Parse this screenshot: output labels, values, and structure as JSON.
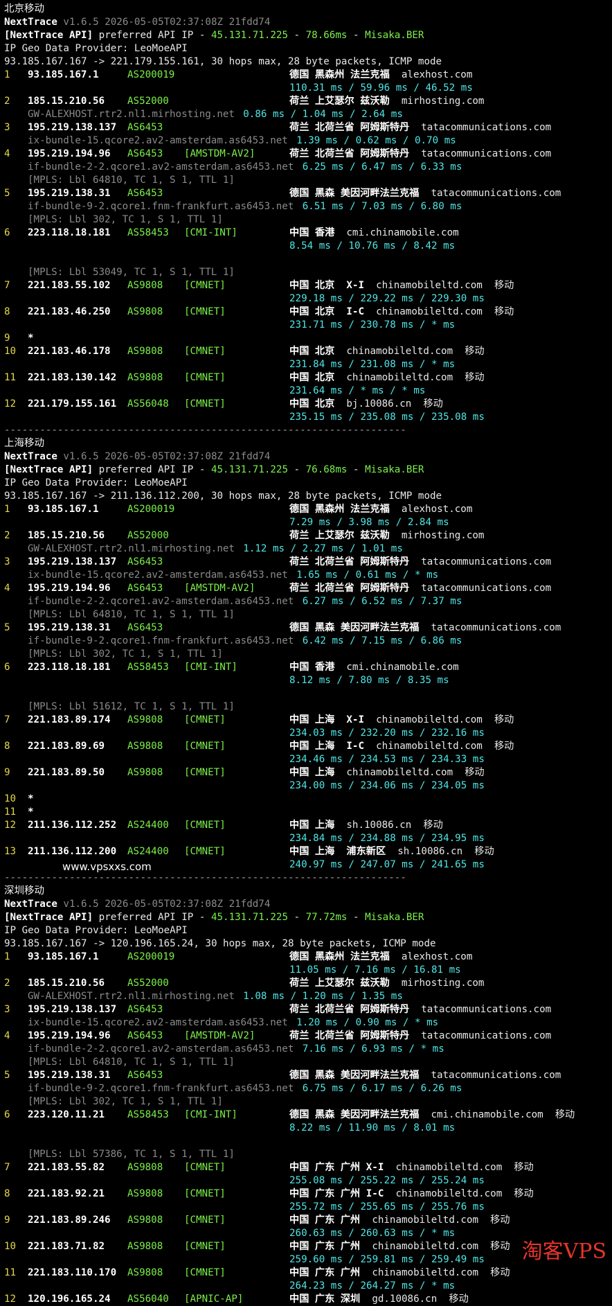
{
  "sections": [
    {
      "title": "北京移动",
      "header": {
        "app": "NextTrace",
        "version": "v1.6.5 2026-05-05T02:37:08Z 21fdd74",
        "api_label": "[NextTrace API]",
        "api_text": " preferred API IP - ",
        "api_ip": "45.131.71.225",
        "dash1": " - ",
        "latency": "78.66ms",
        "dash2": " - ",
        "node": "Misaka.BER",
        "provider": "IP Geo Data Provider: LeoMoeAPI",
        "route": "93.185.167.167 -> 221.179.155.161, 30 hops max, 28 byte packets, ICMP mode"
      },
      "hops": [
        {
          "hop": "1",
          "ip": "93.185.167.1",
          "asn": "AS200019",
          "tag": "",
          "geo": "德国 黑森州 法兰克福",
          "host": "alexhost.com",
          "isp": "",
          "rtt": "110.31 ms / 59.96 ms / 46.52 ms",
          "sub": []
        },
        {
          "hop": "2",
          "ip": "185.15.210.56",
          "asn": "AS52000",
          "tag": "",
          "geo": "荷兰 上艾瑟尔 兹沃勒",
          "host": "mirhosting.com",
          "isp": "",
          "rtt": "0.86 ms / 1.04 ms / 2.64 ms",
          "rdns": "GW-ALEXHOST.rtr2.nl1.mirhosting.net",
          "sub": []
        },
        {
          "hop": "3",
          "ip": "195.219.138.137",
          "asn": "AS6453",
          "tag": "",
          "geo": "荷兰 北荷兰省 阿姆斯特丹",
          "host": "tatacommunications.com",
          "isp": "",
          "rtt": "1.39 ms / 0.62 ms / 0.70 ms",
          "rdns": "ix-bundle-15.qcore2.av2-amsterdam.as6453.net",
          "sub": []
        },
        {
          "hop": "4",
          "ip": "195.219.194.96",
          "asn": "AS6453",
          "tag": "[AMSTDM-AV2]",
          "geo": "荷兰 北荷兰省 阿姆斯特丹",
          "host": "tatacommunications.com",
          "isp": "",
          "rtt": "6.25 ms / 6.47 ms / 6.33 ms",
          "rdns": "if-bundle-2-2.qcore1.av2-amsterdam.as6453.net",
          "sub": [
            "[MPLS: Lbl 64810, TC 1, S 1, TTL 1]"
          ]
        },
        {
          "hop": "5",
          "ip": "195.219.138.31",
          "asn": "AS6453",
          "tag": "",
          "geo": "德国 黑森 美因河畔法兰克福",
          "host": "tatacommunications.com",
          "isp": "",
          "rtt": "6.51 ms / 7.03 ms / 6.80 ms",
          "rdns": "if-bundle-9-2.qcore1.fnm-frankfurt.as6453.net",
          "sub": [
            "[MPLS: Lbl 302, TC 1, S 1, TTL 1]"
          ]
        },
        {
          "hop": "6",
          "ip": "223.118.18.181",
          "asn": "AS58453",
          "tag": "[CMI-INT]",
          "geo": "中国 香港",
          "host": "cmi.chinamobile.com",
          "isp": "",
          "rtt": "8.54 ms / 10.76 ms / 8.42 ms",
          "sub": [
            "",
            "[MPLS: Lbl 53049, TC 1, S 1, TTL 1]"
          ]
        },
        {
          "hop": "7",
          "ip": "221.183.55.102",
          "asn": "AS9808",
          "tag": "[CMNET]",
          "geo": "中国 北京  X-I",
          "host": "chinamobileltd.com",
          "isp": "移动",
          "rtt": "229.18 ms / 229.22 ms / 229.30 ms",
          "sub": []
        },
        {
          "hop": "8",
          "ip": "221.183.46.250",
          "asn": "AS9808",
          "tag": "[CMNET]",
          "geo": "中国 北京  I-C",
          "host": "chinamobileltd.com",
          "isp": "移动",
          "rtt": "231.71 ms / 230.78 ms / * ms",
          "sub": []
        },
        {
          "hop": "9",
          "ip": "*",
          "asn": "",
          "tag": "",
          "geo": "",
          "host": "",
          "isp": "",
          "sub": []
        },
        {
          "hop": "10",
          "ip": "221.183.46.178",
          "asn": "AS9808",
          "tag": "[CMNET]",
          "geo": "中国 北京",
          "host": "chinamobileltd.com",
          "isp": "移动",
          "rtt": "231.84 ms / 231.08 ms / * ms",
          "sub": []
        },
        {
          "hop": "11",
          "ip": "221.183.130.142",
          "asn": "AS9808",
          "tag": "[CMNET]",
          "geo": "中国 北京",
          "host": "chinamobileltd.com",
          "isp": "移动",
          "rtt": "231.64 ms / * ms / * ms",
          "sub": []
        },
        {
          "hop": "12",
          "ip": "221.179.155.161",
          "asn": "AS56048",
          "tag": "[CMNET]",
          "geo": "中国 北京",
          "host": "bj.10086.cn",
          "isp": "移动",
          "rtt": "235.15 ms / 235.08 ms / 235.08 ms",
          "sub": []
        }
      ]
    },
    {
      "title": "上海移动",
      "header": {
        "app": "NextTrace",
        "version": "v1.6.5 2026-05-05T02:37:08Z 21fdd74",
        "api_label": "[NextTrace API]",
        "api_text": " preferred API IP - ",
        "api_ip": "45.131.71.225",
        "dash1": " - ",
        "latency": "76.68ms",
        "dash2": " - ",
        "node": "Misaka.BER",
        "provider": "IP Geo Data Provider: LeoMoeAPI",
        "route": "93.185.167.167 -> 211.136.112.200, 30 hops max, 28 byte packets, ICMP mode"
      },
      "hops": [
        {
          "hop": "1",
          "ip": "93.185.167.1",
          "asn": "AS200019",
          "tag": "",
          "geo": "德国 黑森州 法兰克福",
          "host": "alexhost.com",
          "isp": "",
          "rtt": "7.29 ms / 3.98 ms / 2.84 ms",
          "sub": []
        },
        {
          "hop": "2",
          "ip": "185.15.210.56",
          "asn": "AS52000",
          "tag": "",
          "geo": "荷兰 上艾瑟尔 兹沃勒",
          "host": "mirhosting.com",
          "isp": "",
          "rtt": "1.12 ms / 2.27 ms / 1.01 ms",
          "rdns": "GW-ALEXHOST.rtr2.nl1.mirhosting.net",
          "sub": []
        },
        {
          "hop": "3",
          "ip": "195.219.138.137",
          "asn": "AS6453",
          "tag": "",
          "geo": "荷兰 北荷兰省 阿姆斯特丹",
          "host": "tatacommunications.com",
          "isp": "",
          "rtt": "1.65 ms / 0.61 ms / * ms",
          "rdns": "ix-bundle-15.qcore2.av2-amsterdam.as6453.net",
          "sub": []
        },
        {
          "hop": "4",
          "ip": "195.219.194.96",
          "asn": "AS6453",
          "tag": "[AMSTDM-AV2]",
          "geo": "荷兰 北荷兰省 阿姆斯特丹",
          "host": "tatacommunications.com",
          "isp": "",
          "rtt": "6.27 ms / 6.52 ms / 7.37 ms",
          "rdns": "if-bundle-2-2.qcore1.av2-amsterdam.as6453.net",
          "sub": [
            "[MPLS: Lbl 64810, TC 1, S 1, TTL 1]"
          ]
        },
        {
          "hop": "5",
          "ip": "195.219.138.31",
          "asn": "AS6453",
          "tag": "",
          "geo": "德国 黑森 美因河畔法兰克福",
          "host": "tatacommunications.com",
          "isp": "",
          "rtt": "6.42 ms / 7.15 ms / 6.86 ms",
          "rdns": "if-bundle-9-2.qcore1.fnm-frankfurt.as6453.net",
          "sub": [
            "[MPLS: Lbl 302, TC 1, S 1, TTL 1]"
          ]
        },
        {
          "hop": "6",
          "ip": "223.118.18.181",
          "asn": "AS58453",
          "tag": "[CMI-INT]",
          "geo": "中国 香港",
          "host": "cmi.chinamobile.com",
          "isp": "",
          "rtt": "8.12 ms / 7.80 ms / 8.35 ms",
          "sub": [
            "",
            "[MPLS: Lbl 51612, TC 1, S 1, TTL 1]"
          ]
        },
        {
          "hop": "7",
          "ip": "221.183.89.174",
          "asn": "AS9808",
          "tag": "[CMNET]",
          "geo": "中国 上海  X-I",
          "host": "chinamobileltd.com",
          "isp": "移动",
          "rtt": "234.03 ms / 232.20 ms / 232.16 ms",
          "sub": []
        },
        {
          "hop": "8",
          "ip": "221.183.89.69",
          "asn": "AS9808",
          "tag": "[CMNET]",
          "geo": "中国 上海  I-C",
          "host": "chinamobileltd.com",
          "isp": "移动",
          "rtt": "234.46 ms / 234.53 ms / 234.33 ms",
          "sub": []
        },
        {
          "hop": "9",
          "ip": "221.183.89.50",
          "asn": "AS9808",
          "tag": "[CMNET]",
          "geo": "中国 上海",
          "host": "chinamobileltd.com",
          "isp": "移动",
          "rtt": "234.00 ms / 234.06 ms / 234.05 ms",
          "sub": []
        },
        {
          "hop": "10",
          "ip": "*",
          "asn": "",
          "tag": "",
          "geo": "",
          "host": "",
          "isp": "",
          "sub": []
        },
        {
          "hop": "11",
          "ip": "*",
          "asn": "",
          "tag": "",
          "geo": "",
          "host": "",
          "isp": "",
          "sub": []
        },
        {
          "hop": "12",
          "ip": "211.136.112.252",
          "asn": "AS24400",
          "tag": "[CMNET]",
          "geo": "中国 上海",
          "host": "sh.10086.cn",
          "isp": "移动",
          "rtt": "234.84 ms / 234.88 ms / 234.95 ms",
          "sub": []
        },
        {
          "hop": "13",
          "ip": "211.136.112.200",
          "asn": "AS24400",
          "tag": "[CMNET]",
          "geo": "中国 上海  浦东新区",
          "host": "sh.10086.cn",
          "isp": "移动",
          "rtt": "240.97 ms / 247.07 ms / 241.65 ms",
          "sub": []
        }
      ]
    },
    {
      "title": "深圳移动",
      "header": {
        "app": "NextTrace",
        "version": "v1.6.5 2026-05-05T02:37:08Z 21fdd74",
        "api_label": "[NextTrace API]",
        "api_text": " preferred API IP - ",
        "api_ip": "45.131.71.225",
        "dash1": " - ",
        "latency": "77.72ms",
        "dash2": " - ",
        "node": "Misaka.BER",
        "provider": "IP Geo Data Provider: LeoMoeAPI",
        "route": "93.185.167.167 -> 120.196.165.24, 30 hops max, 28 byte packets, ICMP mode"
      },
      "hops": [
        {
          "hop": "1",
          "ip": "93.185.167.1",
          "asn": "AS200019",
          "tag": "",
          "geo": "德国 黑森州 法兰克福",
          "host": "alexhost.com",
          "isp": "",
          "rtt": "11.05 ms / 7.16 ms / 16.81 ms",
          "sub": []
        },
        {
          "hop": "2",
          "ip": "185.15.210.56",
          "asn": "AS52000",
          "tag": "",
          "geo": "荷兰 上艾瑟尔 兹沃勒",
          "host": "mirhosting.com",
          "isp": "",
          "rtt": "1.08 ms / 1.20 ms / 1.35 ms",
          "rdns": "GW-ALEXHOST.rtr2.nl1.mirhosting.net",
          "sub": []
        },
        {
          "hop": "3",
          "ip": "195.219.138.137",
          "asn": "AS6453",
          "tag": "",
          "geo": "荷兰 北荷兰省 阿姆斯特丹",
          "host": "tatacommunications.com",
          "isp": "",
          "rtt": "1.20 ms / 0.90 ms / * ms",
          "rdns": "ix-bundle-15.qcore2.av2-amsterdam.as6453.net",
          "sub": []
        },
        {
          "hop": "4",
          "ip": "195.219.194.96",
          "asn": "AS6453",
          "tag": "[AMSTDM-AV2]",
          "geo": "荷兰 北荷兰省 阿姆斯特丹",
          "host": "tatacommunications.com",
          "isp": "",
          "rtt": "7.16 ms / 6.93 ms / * ms",
          "rdns": "if-bundle-2-2.qcore1.av2-amsterdam.as6453.net",
          "sub": [
            "[MPLS: Lbl 64810, TC 1, S 1, TTL 1]"
          ]
        },
        {
          "hop": "5",
          "ip": "195.219.138.31",
          "asn": "AS6453",
          "tag": "",
          "geo": "德国 黑森 美因河畔法兰克福",
          "host": "tatacommunications.com",
          "isp": "",
          "rtt": "6.75 ms / 6.17 ms / 6.26 ms",
          "rdns": "if-bundle-9-2.qcore1.fnm-frankfurt.as6453.net",
          "sub": [
            "[MPLS: Lbl 302, TC 1, S 1, TTL 1]"
          ]
        },
        {
          "hop": "6",
          "ip": "223.120.11.21",
          "asn": "AS58453",
          "tag": "[CMI-INT]",
          "geo": "德国 黑森 美因河畔法兰克福",
          "host": "cmi.chinamobile.com",
          "isp": "移动",
          "rtt": "8.22 ms / 11.90 ms / 8.01 ms",
          "sub": [
            "",
            "[MPLS: Lbl 57386, TC 1, S 1, TTL 1]"
          ]
        },
        {
          "hop": "7",
          "ip": "221.183.55.82",
          "asn": "AS9808",
          "tag": "[CMNET]",
          "geo": "中国 广东 广州 X-I",
          "host": "chinamobileltd.com",
          "isp": "移动",
          "rtt": "255.08 ms / 255.22 ms / 255.24 ms",
          "sub": []
        },
        {
          "hop": "8",
          "ip": "221.183.92.21",
          "asn": "AS9808",
          "tag": "[CMNET]",
          "geo": "中国 广东 广州 I-C",
          "host": "chinamobileltd.com",
          "isp": "移动",
          "rtt": "255.72 ms / 255.65 ms / 255.76 ms",
          "sub": []
        },
        {
          "hop": "9",
          "ip": "221.183.89.246",
          "asn": "AS9808",
          "tag": "[CMNET]",
          "geo": "中国 广东 广州",
          "host": "chinamobileltd.com",
          "isp": "移动",
          "rtt": "260.63 ms / 260.63 ms / * ms",
          "sub": []
        },
        {
          "hop": "10",
          "ip": "221.183.71.82",
          "asn": "AS9808",
          "tag": "[CMNET]",
          "geo": "中国 广东 广州",
          "host": "chinamobileltd.com",
          "isp": "移动",
          "rtt": "259.60 ms / 259.81 ms / 259.49 ms",
          "sub": []
        },
        {
          "hop": "11",
          "ip": "221.183.110.170",
          "asn": "AS9808",
          "tag": "[CMNET]",
          "geo": "中国 广东 广州",
          "host": "chinamobileltd.com",
          "isp": "移动",
          "rtt": "264.23 ms / 264.27 ms / * ms",
          "sub": []
        },
        {
          "hop": "12",
          "ip": "120.196.165.24",
          "asn": "AS56040",
          "tag": "[APNIC-AP]",
          "geo": "中国 广东 深圳",
          "host": "gd.10086.cn",
          "isp": "移动",
          "sub": []
        }
      ]
    }
  ],
  "separator": "--------------------------------------------------------------------",
  "site_label": "www.vpsxxs.com",
  "watermark": "淘客VPS",
  "colors": {
    "green": "#7cf04a",
    "cyan": "#4fe6e6",
    "yellow": "#e8d84a",
    "gray": "#8a8a8a"
  }
}
